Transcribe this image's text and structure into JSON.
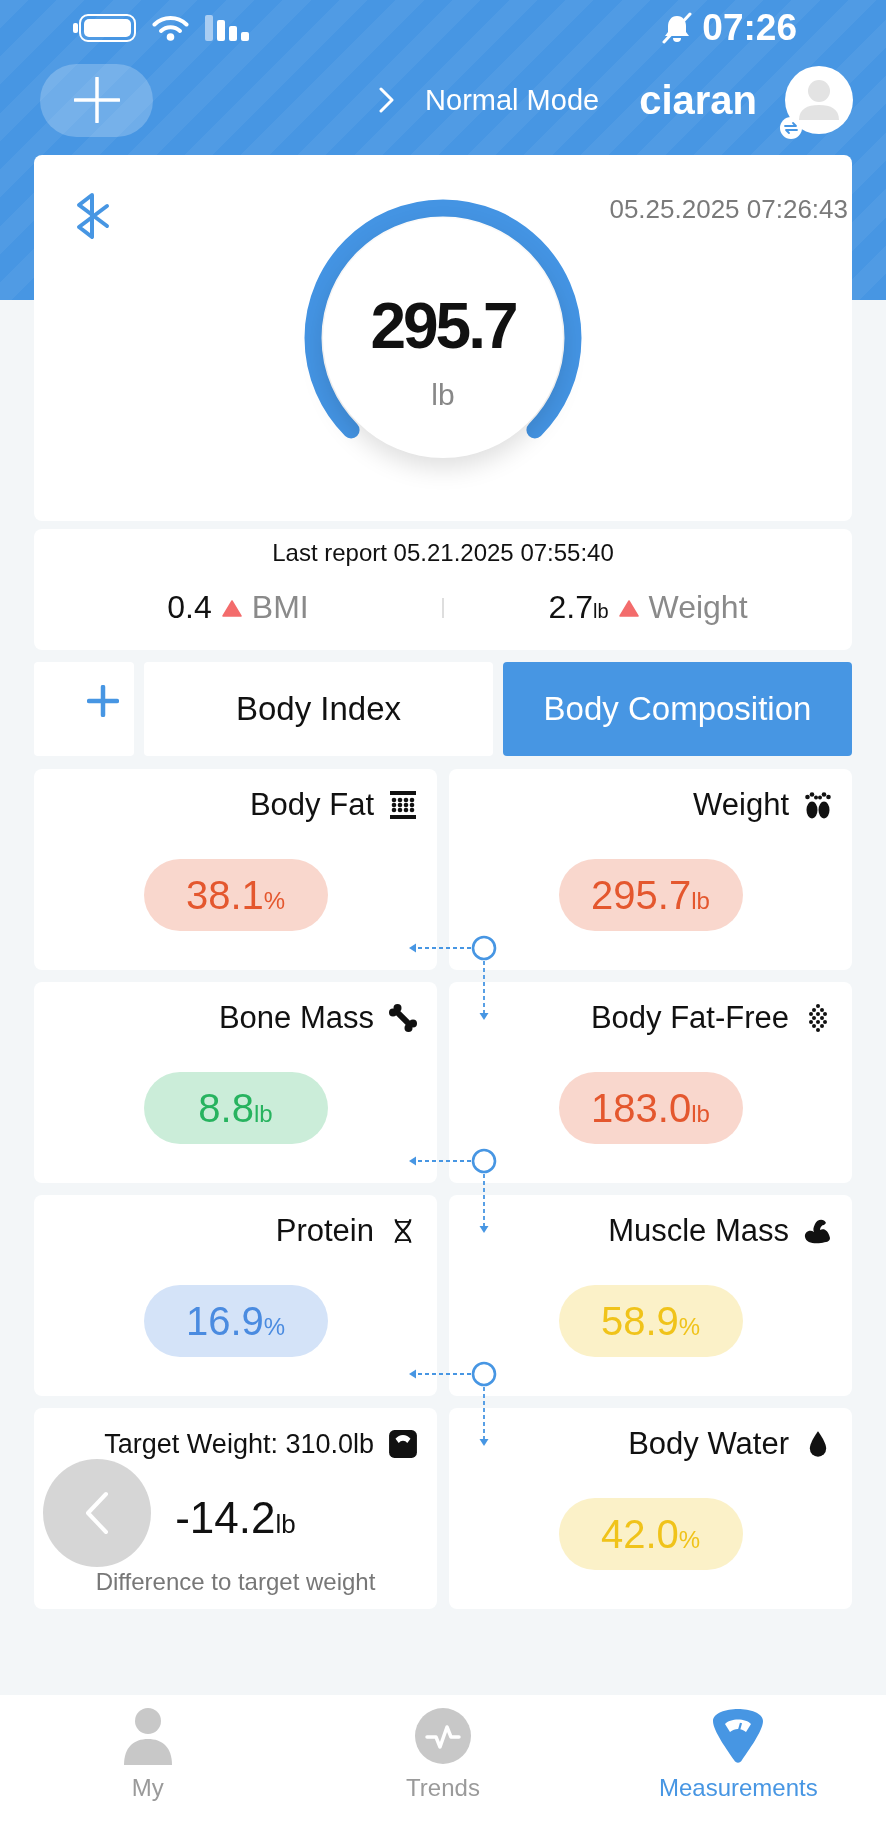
{
  "status_bar": {
    "time": "07:26"
  },
  "header": {
    "user_name": "ciaran",
    "mode": "Normal Mode"
  },
  "measurement": {
    "timestamp": "05.25.2025 07:26:43",
    "value": "295.7",
    "unit": "lb"
  },
  "last_report": {
    "title": "Last report 05.21.2025 07:55:40",
    "changes": [
      {
        "name": "BMI",
        "rising": true,
        "value": "0.4"
      },
      {
        "name": "Weight",
        "rising": true,
        "value": "2.7",
        "unit": "lb"
      }
    ]
  },
  "tabs": [
    {
      "label": "Body Index",
      "selected": false
    },
    {
      "label": "Body Composition",
      "selected": true
    }
  ],
  "metrics": [
    {
      "kind": "pill",
      "name": "Body Fat",
      "value": "38.1",
      "unit": "%",
      "color": "#e4572e"
    },
    {
      "kind": "pill",
      "name": "Weight",
      "value": "295.7",
      "unit": "lb",
      "color": "#e4572e"
    },
    {
      "kind": "pill",
      "name": "Bone Mass",
      "value": "8.8",
      "unit": "lb",
      "color": "#27b35f"
    },
    {
      "kind": "pill",
      "name": "Body Fat-Free",
      "value": "183.0",
      "unit": "lb",
      "color": "#e4572e"
    },
    {
      "kind": "pill",
      "name": "Protein",
      "value": "16.9",
      "unit": "%",
      "color": "#4a8be0"
    },
    {
      "kind": "pill",
      "name": "Muscle Mass",
      "value": "58.9",
      "unit": "%",
      "color": "#f0c31a"
    },
    {
      "kind": "target",
      "name": "Target Weight: 310.0lb",
      "value": "-14.2",
      "unit": "lb",
      "caption": "Difference to target weight"
    },
    {
      "kind": "pill",
      "name": "Body Water",
      "value": "42.0",
      "unit": "%",
      "color": "#f0c31a"
    }
  ],
  "bottom_nav": [
    {
      "label": "My",
      "selected": false
    },
    {
      "label": "Trends",
      "selected": false
    },
    {
      "label": "Measurements",
      "selected": true
    }
  ]
}
